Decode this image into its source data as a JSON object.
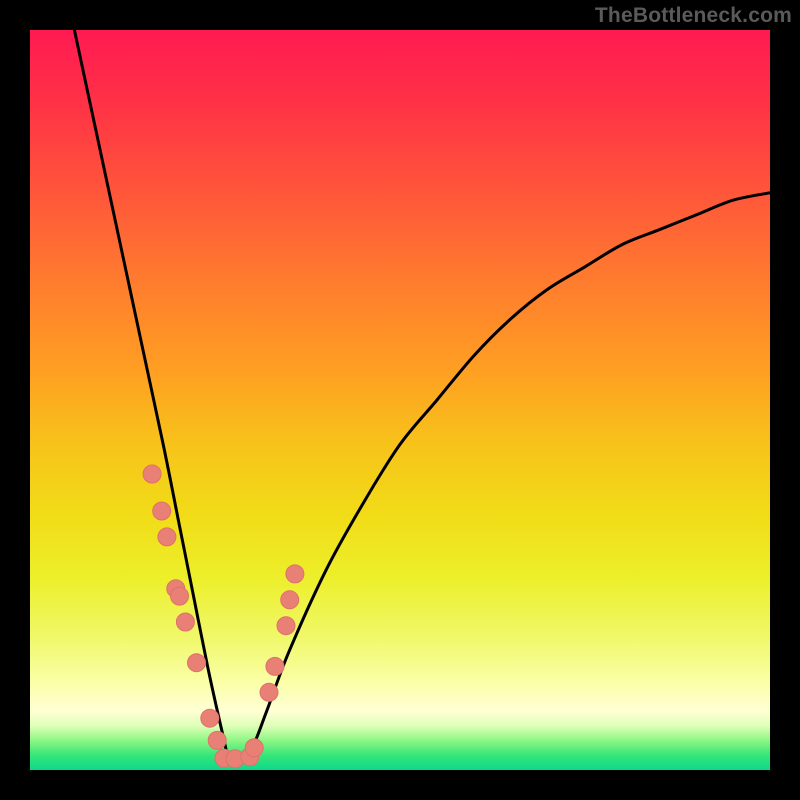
{
  "watermark": "TheBottleneck.com",
  "colors": {
    "dot_fill": "#e88076",
    "dot_stroke": "#e07068",
    "curve": "#000000",
    "frame": "#000000"
  },
  "chart_data": {
    "type": "line",
    "title": "",
    "xlabel": "",
    "ylabel": "",
    "xlim": [
      0,
      100
    ],
    "ylim": [
      0,
      100
    ],
    "grid": false,
    "legend": false,
    "annotations": [],
    "description": "V-shaped bottleneck curve over rainbow gradient. Vertex near x≈27, y≈0. Left branch rises steeply toward (≈6,100); right branch rises with decreasing slope toward (100,≈78). Salmon dots cluster along both branches in the lower ~40% of the y-range and along the flat trough.",
    "series": [
      {
        "name": "bottleneck-curve",
        "x": [
          6,
          9,
          12,
          15,
          18,
          20,
          22,
          24,
          26,
          27,
          28,
          30,
          32,
          35,
          40,
          45,
          50,
          55,
          60,
          65,
          70,
          75,
          80,
          85,
          90,
          95,
          100
        ],
        "y": [
          100,
          86,
          72,
          58,
          44,
          34,
          24,
          14,
          5,
          1,
          1,
          3,
          8,
          16,
          27,
          36,
          44,
          50,
          56,
          61,
          65,
          68,
          71,
          73,
          75,
          77,
          78
        ]
      },
      {
        "name": "marker-dots",
        "x": [
          16.5,
          17.8,
          18.5,
          19.7,
          20.2,
          21.0,
          22.5,
          24.3,
          25.3,
          26.2,
          27.7,
          29.7,
          30.3,
          32.3,
          33.1,
          34.6,
          35.1,
          35.8
        ],
        "y": [
          40.0,
          35.0,
          31.5,
          24.5,
          23.5,
          20.0,
          14.5,
          7.0,
          4.0,
          1.6,
          1.5,
          1.8,
          3.0,
          10.5,
          14.0,
          19.5,
          23.0,
          26.5
        ]
      }
    ]
  }
}
